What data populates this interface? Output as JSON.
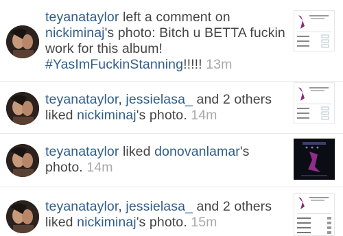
{
  "activity": [
    {
      "user": "teyanataylor",
      "segments": [
        {
          "text": "teyanataylor",
          "kind": "user"
        },
        {
          "text": " left a comment on ",
          "kind": "plain"
        },
        {
          "text": "nickiminaj",
          "kind": "user"
        },
        {
          "text": "'s photo: Bitch u BETTA fuckin work for this album! ",
          "kind": "plain"
        },
        {
          "text": "#YasImFuckinStanning",
          "kind": "hashtag"
        },
        {
          "text": "!!!!! ",
          "kind": "plain"
        }
      ],
      "time": "13m",
      "thumbnail": "album-tracklist-photo-icon"
    },
    {
      "user": "teyanataylor",
      "segments": [
        {
          "text": "teyanataylor",
          "kind": "user"
        },
        {
          "text": ", ",
          "kind": "plain"
        },
        {
          "text": "jessielasa_",
          "kind": "user"
        },
        {
          "text": " and 2 others liked ",
          "kind": "plain"
        },
        {
          "text": "nickiminaj",
          "kind": "user"
        },
        {
          "text": "'s photo. ",
          "kind": "plain"
        }
      ],
      "time": "14m",
      "thumbnail": "album-tracklist-photo-icon"
    },
    {
      "user": "teyanataylor",
      "segments": [
        {
          "text": "teyanataylor",
          "kind": "user"
        },
        {
          "text": " liked ",
          "kind": "plain"
        },
        {
          "text": "donovanlamar",
          "kind": "user"
        },
        {
          "text": "'s photo. ",
          "kind": "plain"
        }
      ],
      "time": "14m",
      "thumbnail": "phone-screenshot-photo-icon"
    },
    {
      "user": "teyanataylor",
      "segments": [
        {
          "text": "teyanataylor",
          "kind": "user"
        },
        {
          "text": ", ",
          "kind": "plain"
        },
        {
          "text": "jessielasa_",
          "kind": "user"
        },
        {
          "text": " and 2 others liked ",
          "kind": "plain"
        },
        {
          "text": "nickiminaj",
          "kind": "user"
        },
        {
          "text": "'s photo. ",
          "kind": "plain"
        }
      ],
      "time": "15m",
      "thumbnail": "album-tracklist-photo-icon"
    }
  ],
  "colors": {
    "username": "#2f5d8a",
    "body_text": "#444444",
    "timestamp": "#a8a8a8",
    "background": "#ffffff"
  }
}
